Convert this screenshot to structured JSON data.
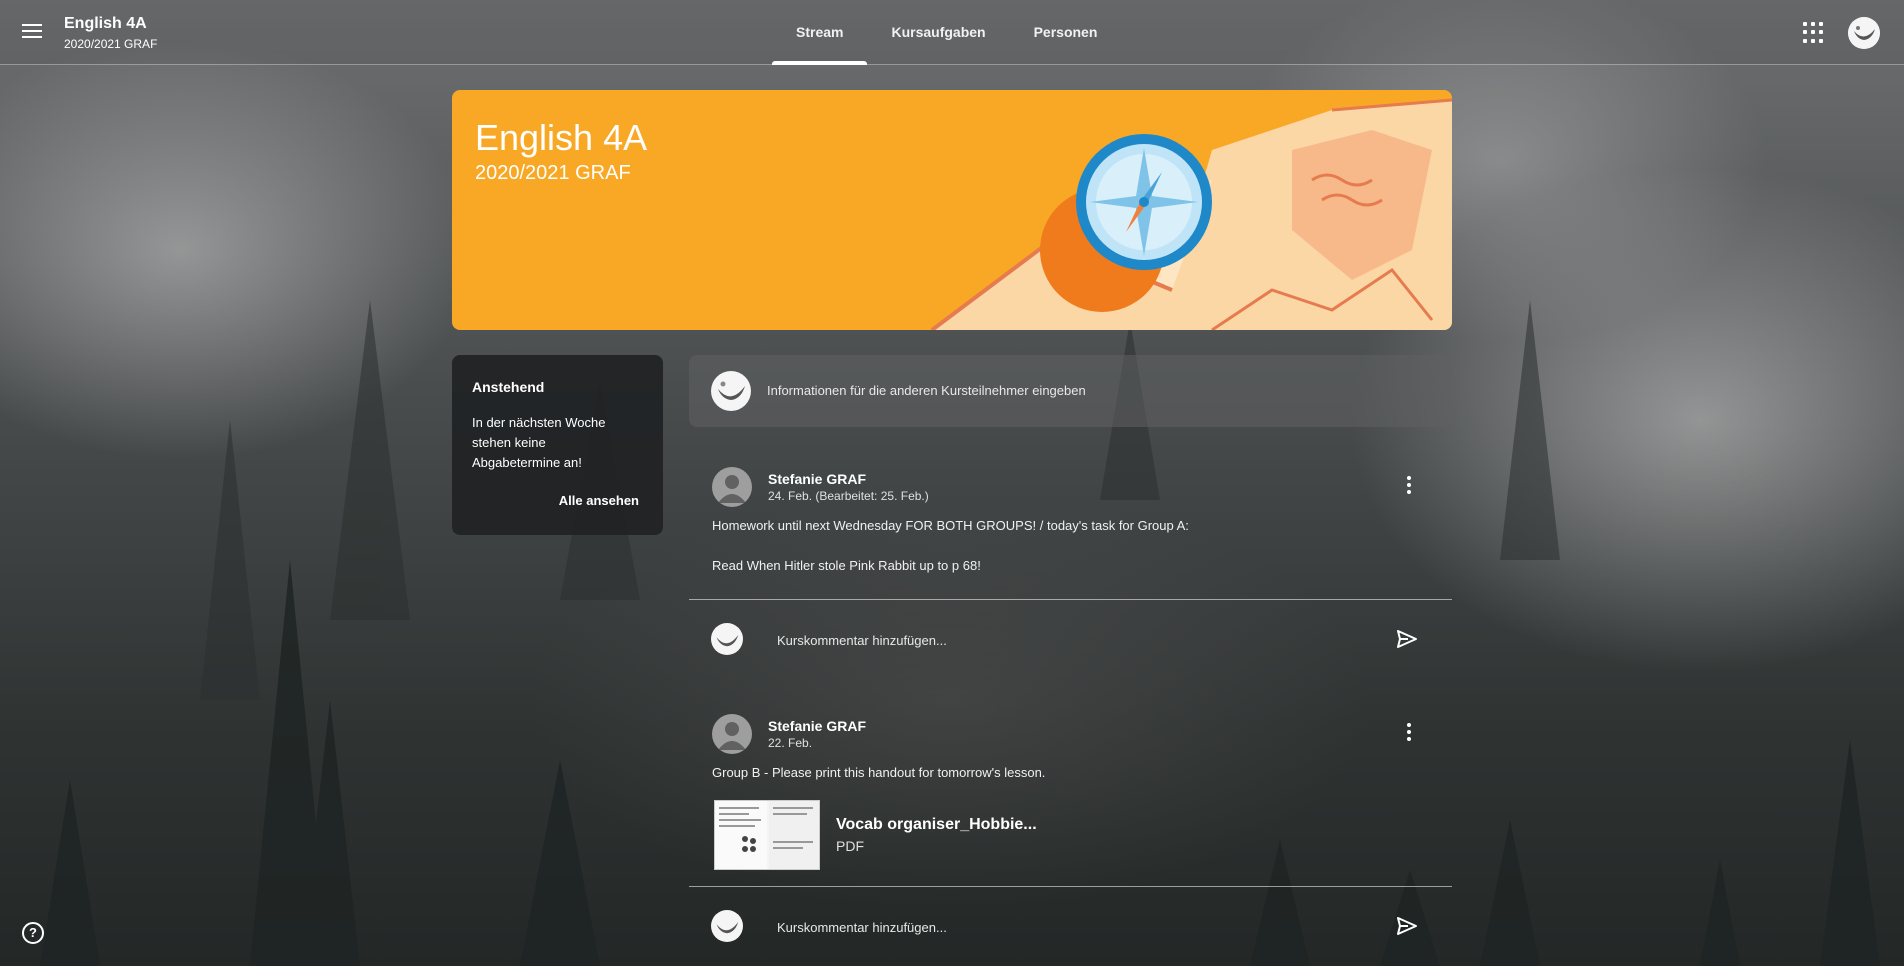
{
  "topbar": {
    "class_title": "English 4A",
    "class_subtitle": "2020/2021 GRAF",
    "tabs": [
      {
        "label": "Stream",
        "active": true
      },
      {
        "label": "Kursaufgaben",
        "active": false
      },
      {
        "label": "Personen",
        "active": false
      }
    ],
    "menu_icon": "hamburger-menu-icon",
    "apps_icon": "apps-grid-icon"
  },
  "banner": {
    "title": "English 4A",
    "subtitle": "2020/2021 GRAF",
    "color": "#f9a825"
  },
  "upcoming": {
    "heading": "Anstehend",
    "message": "In der nächsten Woche stehen keine Abgabetermine an!",
    "view_all": "Alle ansehen"
  },
  "announce": {
    "placeholder": "Informationen für die anderen Kursteilnehmer eingeben"
  },
  "posts": [
    {
      "author": "Stefanie GRAF",
      "date": "24. Feb. (Bearbeitet: 25. Feb.)",
      "line1": "Homework until next Wednesday FOR BOTH GROUPS! / today's task for Group A:",
      "line2": "Read When Hitler stole Pink Rabbit up to p 68!",
      "comment_placeholder": "Kurskommentar hinzufügen..."
    },
    {
      "author": "Stefanie GRAF",
      "date": "22. Feb.",
      "line1": "Group B - Please print this handout for tomorrow's lesson.",
      "attachment": {
        "name": "Vocab organiser_Hobbie...",
        "type": "PDF"
      },
      "comment_placeholder": "Kurskommentar hinzufügen..."
    }
  ],
  "help_icon": "help-circle-icon",
  "help_label": "?"
}
